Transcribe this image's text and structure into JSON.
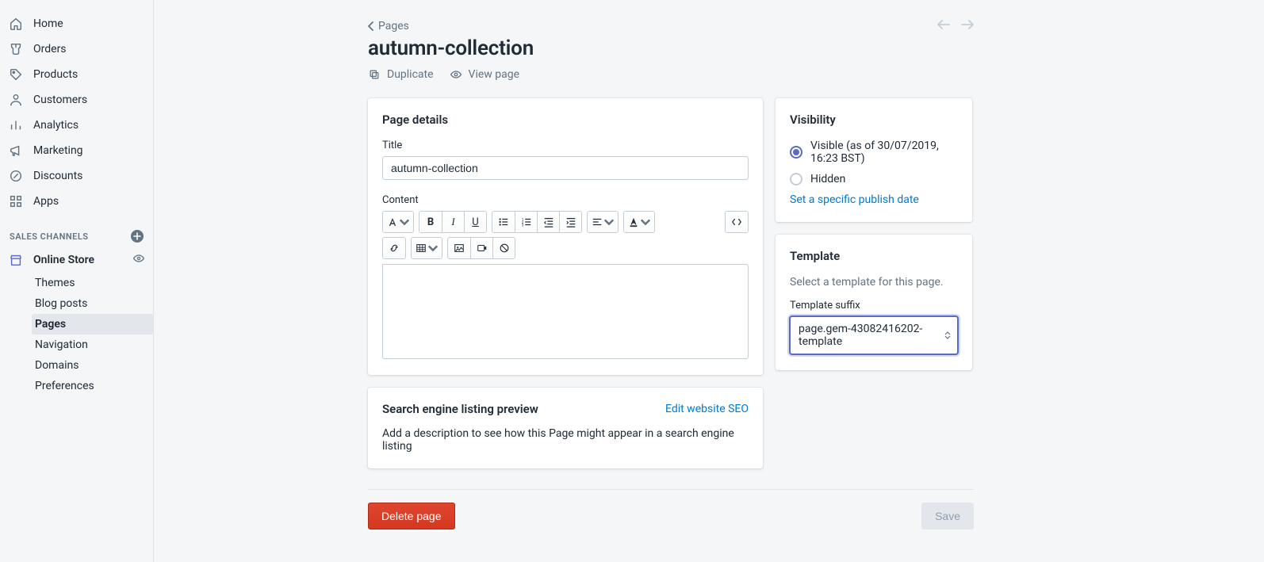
{
  "sidebar": {
    "items": [
      {
        "label": "Home"
      },
      {
        "label": "Orders"
      },
      {
        "label": "Products"
      },
      {
        "label": "Customers"
      },
      {
        "label": "Analytics"
      },
      {
        "label": "Marketing"
      },
      {
        "label": "Discounts"
      },
      {
        "label": "Apps"
      }
    ],
    "channels_heading": "SALES CHANNELS",
    "online_store": "Online Store",
    "sub": [
      {
        "label": "Themes"
      },
      {
        "label": "Blog posts"
      },
      {
        "label": "Pages"
      },
      {
        "label": "Navigation"
      },
      {
        "label": "Domains"
      },
      {
        "label": "Preferences"
      }
    ]
  },
  "breadcrumb": "Pages",
  "title": "autumn-collection",
  "actions": {
    "duplicate": "Duplicate",
    "view": "View page"
  },
  "details": {
    "heading": "Page details",
    "title_label": "Title",
    "title_value": "autumn-collection",
    "content_label": "Content"
  },
  "seo": {
    "heading": "Search engine listing preview",
    "edit": "Edit website SEO",
    "hint": "Add a description to see how this Page might appear in a search engine listing"
  },
  "visibility": {
    "heading": "Visibility",
    "visible": "Visible (as of 30/07/2019, 16:23 BST)",
    "hidden": "Hidden",
    "set_date": "Set a specific publish date"
  },
  "template": {
    "heading": "Template",
    "desc": "Select a template for this page.",
    "suffix_label": "Template suffix",
    "value": "page.gem-43082416202-template"
  },
  "footer": {
    "delete": "Delete page",
    "save": "Save"
  }
}
